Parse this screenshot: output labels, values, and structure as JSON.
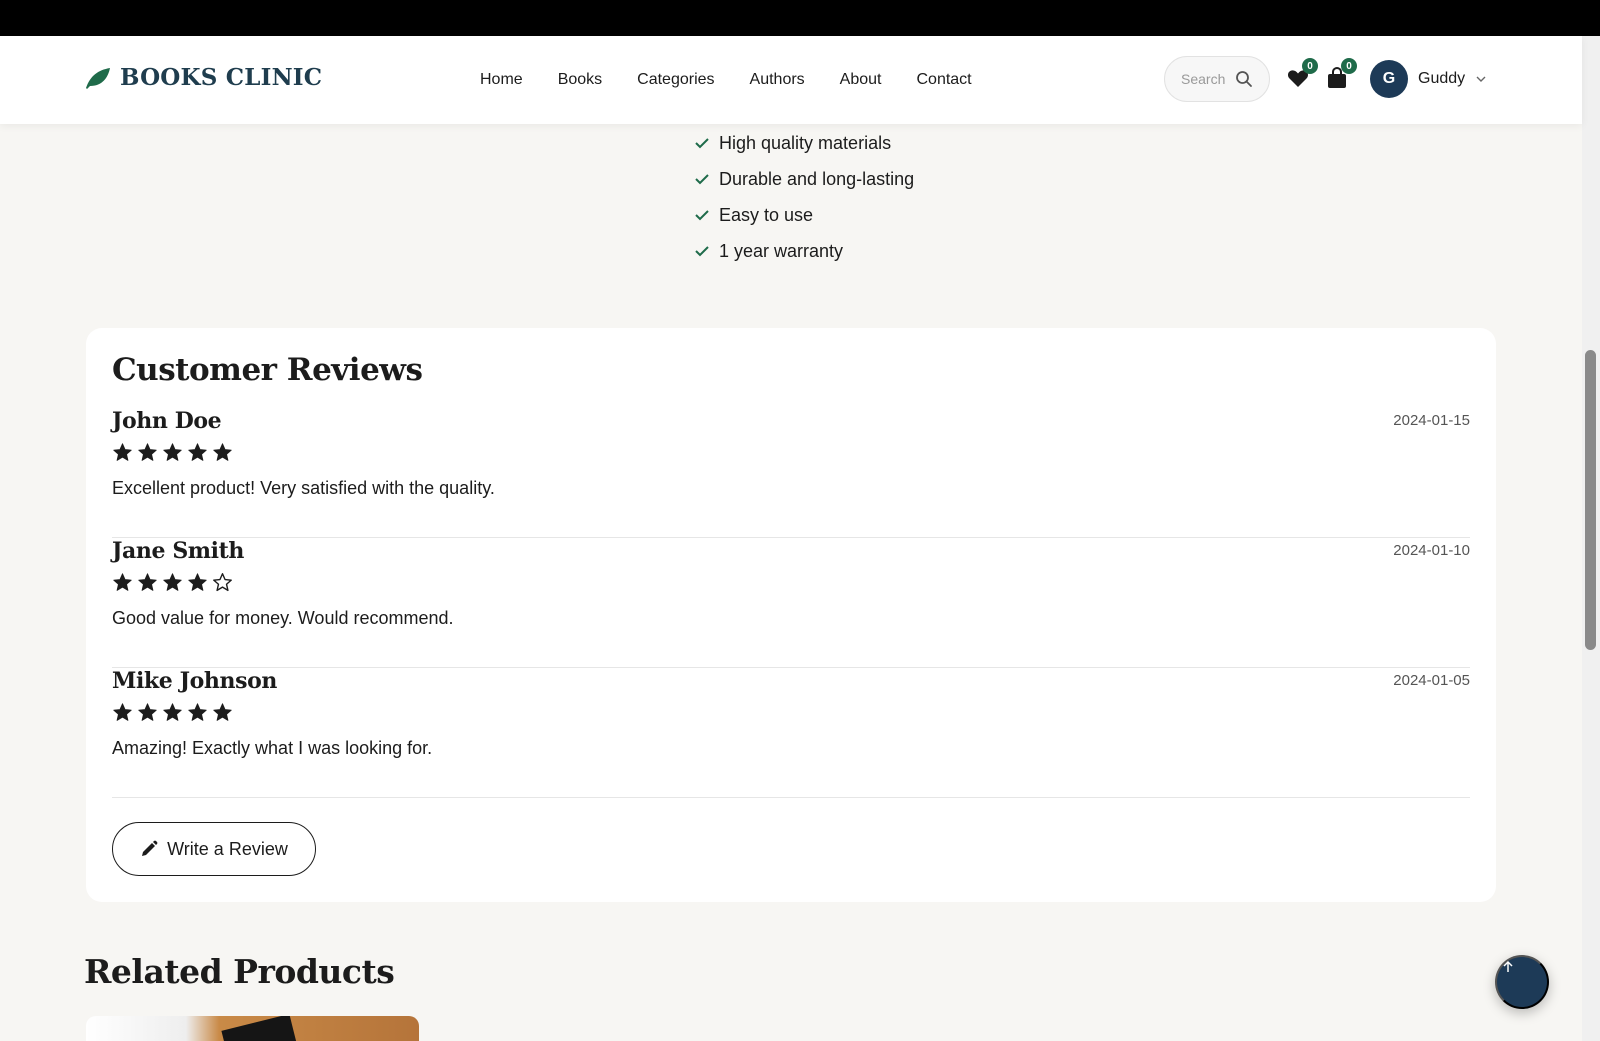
{
  "brand": {
    "name": "BOOKS CLINIC",
    "icon": "leaf-icon",
    "color": "#1f6b4a"
  },
  "nav": {
    "links": [
      "Home",
      "Books",
      "Categories",
      "Authors",
      "About",
      "Contact"
    ]
  },
  "header": {
    "search_placeholder": "Search",
    "wishlist_count": "0",
    "cart_count": "0",
    "user": {
      "initial": "G",
      "name": "Guddy"
    }
  },
  "features": [
    "High quality materials",
    "Durable and long-lasting",
    "Easy to use",
    "1 year warranty"
  ],
  "reviews": {
    "title": "Customer Reviews",
    "items": [
      {
        "name": "John Doe",
        "date": "2024-01-15",
        "rating": 5,
        "text": "Excellent product! Very satisfied with the quality."
      },
      {
        "name": "Jane Smith",
        "date": "2024-01-10",
        "rating": 4,
        "text": "Good value for money. Would recommend."
      },
      {
        "name": "Mike Johnson",
        "date": "2024-01-05",
        "rating": 5,
        "text": "Amazing! Exactly what I was looking for."
      }
    ],
    "write_label": "Write a Review"
  },
  "related": {
    "title": "Related Products"
  },
  "colors": {
    "accent": "#1f6b4a",
    "navy": "#1d3a57",
    "text": "#1c1c1c",
    "background": "#f7f6f3"
  }
}
